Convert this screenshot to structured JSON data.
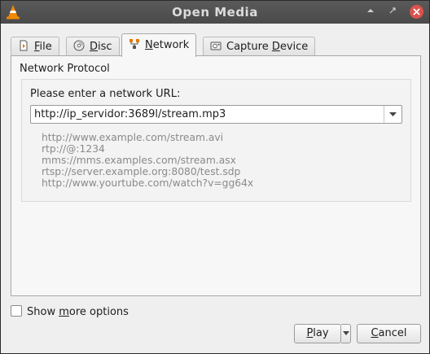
{
  "window": {
    "title": "Open Media"
  },
  "tabs": [
    {
      "label": "File",
      "icon": "file-icon",
      "accel": "F",
      "rest": "ile"
    },
    {
      "label": "Disc",
      "icon": "disc-icon",
      "accel": "D",
      "rest": "isc"
    },
    {
      "label": "Network",
      "icon": "network-icon",
      "accel": "N",
      "rest": "etwork",
      "active": true
    },
    {
      "label": "Capture Device",
      "icon": "capture-device-icon",
      "pre": "Capture ",
      "accel": "D",
      "rest": "evice"
    }
  ],
  "network": {
    "group_title": "Network Protocol",
    "url_label": "Please enter a network URL:",
    "url_value": "http://ip_servidor:3689l/stream.mp3",
    "examples": [
      "http://www.example.com/stream.avi",
      "rtp://@:1234",
      "mms://mms.examples.com/stream.asx",
      "rtsp://server.example.org:8080/test.sdp",
      "http://www.yourtube.com/watch?v=gg64x"
    ]
  },
  "options": {
    "show_more_pre": "Show ",
    "show_more_accel": "m",
    "show_more_rest": "ore options",
    "show_more_checked": false
  },
  "buttons": {
    "play_accel": "P",
    "play_rest": "lay",
    "cancel_accel": "C",
    "cancel_rest": "ancel"
  }
}
